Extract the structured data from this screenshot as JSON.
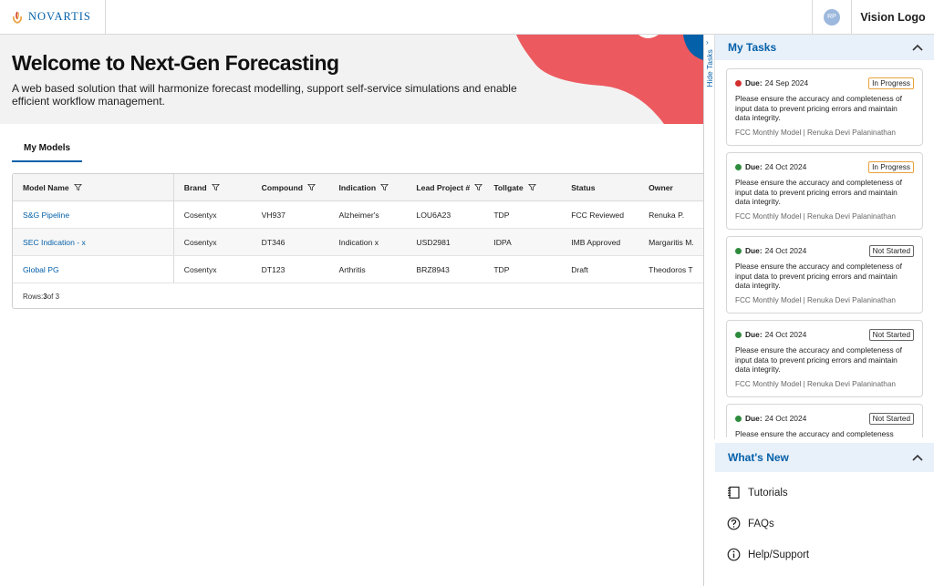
{
  "header": {
    "brand": "NOVARTIS",
    "avatar_initials": "RP",
    "vision_logo": "Vision Logo"
  },
  "hero": {
    "title": "Welcome to Next-Gen Forecasting",
    "subtitle": "A web based solution that will harmonize forecast modelling, support self-service simulations and enable efficient workflow management."
  },
  "tabs": [
    {
      "label": "My Models"
    }
  ],
  "table": {
    "columns": [
      "Model Name",
      "Brand",
      "Compound",
      "Indication",
      "Lead Project #",
      "Tollgate",
      "Status",
      "Owner"
    ],
    "rows": [
      [
        "S&G Pipeline",
        "Cosentyx",
        "VH937",
        "Alzheimer's",
        "LOU6A23",
        "TDP",
        "FCC Reviewed",
        "Renuka P."
      ],
      [
        "SEC Indication - x",
        "Cosentyx",
        "DT346",
        "Indication x",
        "USD2981",
        "IDPA",
        "IMB Approved",
        "Margaritis M."
      ],
      [
        "Global PG",
        "Cosentyx",
        "DT123",
        "Arthritis",
        "BRZ8943",
        "TDP",
        "Draft",
        "Theodoros T"
      ]
    ],
    "footer_prefix": "Rows: ",
    "footer_count": "3",
    "footer_suffix": " of 3"
  },
  "tasks": {
    "hide_label": "Hide Tasks",
    "title": "My Tasks",
    "items": [
      {
        "due_label": "Due:",
        "due_date": "24 Sep 2024",
        "status": "In Progress",
        "dot_color": "#d32f2f",
        "body": "Please ensure the accuracy and completeness of input data to prevent pricing errors and maintain data integrity.",
        "meta": "FCC Monthly Model | Renuka Devi Palaninathan"
      },
      {
        "due_label": "Due:",
        "due_date": "24 Oct 2024",
        "status": "In Progress",
        "dot_color": "#2e8b3d",
        "body": "Please ensure the accuracy and completeness of input data to prevent pricing errors and maintain data integrity.",
        "meta": "FCC Monthly Model | Renuka Devi Palaninathan"
      },
      {
        "due_label": "Due:",
        "due_date": "24 Oct 2024",
        "status": "Not Started",
        "dot_color": "#2e8b3d",
        "body": "Please ensure the accuracy and completeness of input data to prevent pricing errors and maintain data integrity.",
        "meta": "FCC Monthly Model | Renuka Devi Palaninathan"
      },
      {
        "due_label": "Due:",
        "due_date": "24 Oct 2024",
        "status": "Not Started",
        "dot_color": "#2e8b3d",
        "body": "Please ensure the accuracy and completeness of input data to prevent pricing errors and maintain data integrity.",
        "meta": "FCC Monthly Model | Renuka Devi Palaninathan"
      },
      {
        "due_label": "Due:",
        "due_date": "24 Oct 2024",
        "status": "Not Started",
        "dot_color": "#2e8b3d",
        "body": "Please ensure the accuracy and completeness",
        "meta": ""
      }
    ]
  },
  "whats_new": {
    "title": "What's New",
    "items": [
      {
        "label": "Tutorials",
        "icon": "tutorials-icon"
      },
      {
        "label": "FAQs",
        "icon": "question-icon"
      },
      {
        "label": "Help/Support",
        "icon": "info-icon"
      }
    ]
  },
  "colors": {
    "brand_blue": "#0460a9",
    "accent_coral": "#ec5a5f",
    "panel_header_bg": "#e8f0f9"
  }
}
